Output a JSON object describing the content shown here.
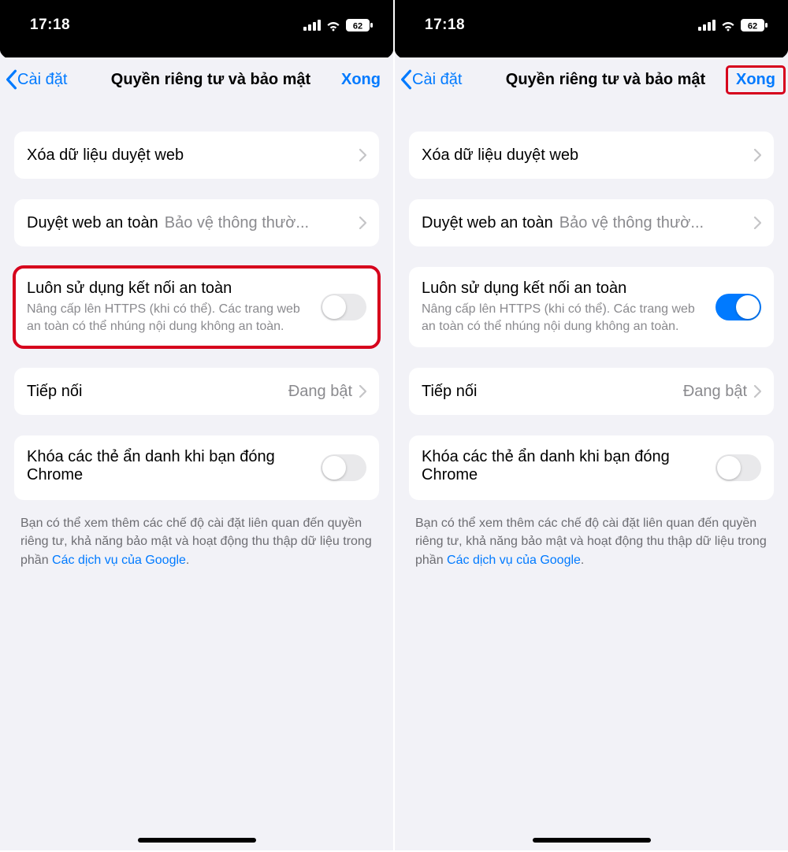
{
  "statusbar": {
    "time": "17:18",
    "battery": "62"
  },
  "nav": {
    "back": "Cài đặt",
    "title": "Quyền riêng tư và bảo mật",
    "done": "Xong"
  },
  "rows": {
    "clear_data": "Xóa dữ liệu duyệt web",
    "safe_browsing": "Duyệt web an toàn",
    "safe_browsing_value": "Bảo vệ thông thườ...",
    "always_https_title": "Luôn sử dụng kết nối an toàn",
    "always_https_desc": "Nâng cấp lên HTTPS (khi có thể). Các trang web an toàn có thể nhúng nội dung không an toàn.",
    "continue": "Tiếp nối",
    "continue_value": "Đang bật",
    "lock_incognito": "Khóa các thẻ ẩn danh khi bạn đóng Chrome"
  },
  "footer": {
    "text": "Bạn có thể xem thêm các chế độ cài đặt liên quan đến quyền riêng tư, khả năng bảo mật và hoạt động thu thập dữ liệu trong phần ",
    "link": "Các dịch vụ của Google",
    "suffix": "."
  }
}
